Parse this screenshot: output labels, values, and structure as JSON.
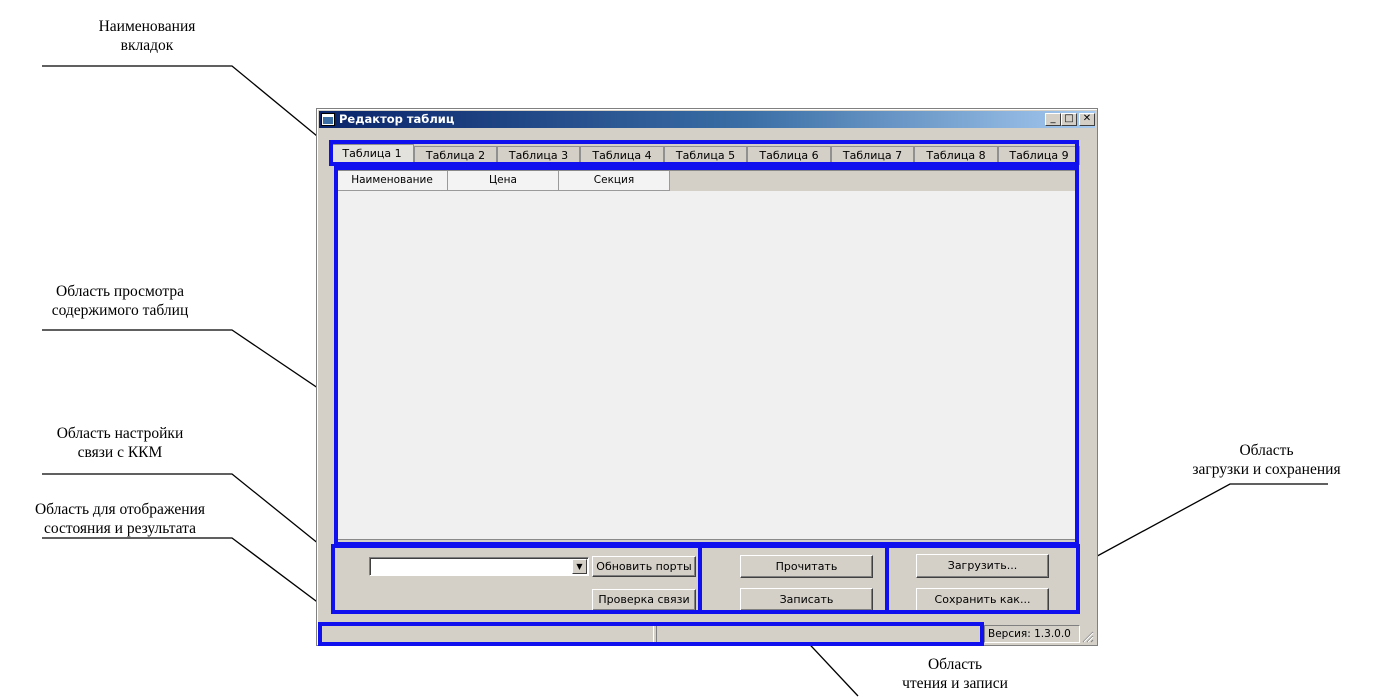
{
  "annotations": {
    "tabs_names": [
      "Наименования",
      "вкладок"
    ],
    "view_area": [
      "Область просмотра",
      "содержимого таблиц"
    ],
    "kkm_settings": [
      "Область настройки",
      "связи с ККМ"
    ],
    "status_area": [
      "Область для отображения",
      "состояния и результата"
    ],
    "load_save": [
      "Область",
      "загрузки и сохранения"
    ],
    "read_write": [
      "Область",
      "чтения и записи"
    ]
  },
  "window": {
    "title": "Редактор таблиц",
    "controls": {
      "minimize": "_",
      "maximize": "□",
      "close": "✕"
    }
  },
  "tabs": [
    "Таблица 1",
    "Таблица 2",
    "Таблица 3",
    "Таблица 4",
    "Таблица 5",
    "Таблица 6",
    "Таблица 7",
    "Таблица 8",
    "Таблица 9"
  ],
  "active_tab": "Таблица 1",
  "table": {
    "columns": [
      "Наименование",
      "Цена",
      "Секция"
    ]
  },
  "connection": {
    "port_value": "",
    "refresh_ports_label": "Обновить порты",
    "check_connection_label": "Проверка связи"
  },
  "read_write": {
    "read_label": "Прочитать",
    "write_label": "Записать"
  },
  "load_save": {
    "load_label": "Загрузить...",
    "save_as_label": "Сохранить как..."
  },
  "status": {
    "panel1": "",
    "panel2": "",
    "version": "Версия: 1.3.0.0"
  },
  "colors": {
    "highlight": "#1010ee",
    "window_face": "#d4d0c8",
    "title_start": "#0a246a",
    "title_end": "#a6caf0"
  },
  "icons": {
    "window_icon": "app-window-icon",
    "combo_arrow": "dropdown-arrow-icon",
    "grip": "resize-grip-icon"
  }
}
